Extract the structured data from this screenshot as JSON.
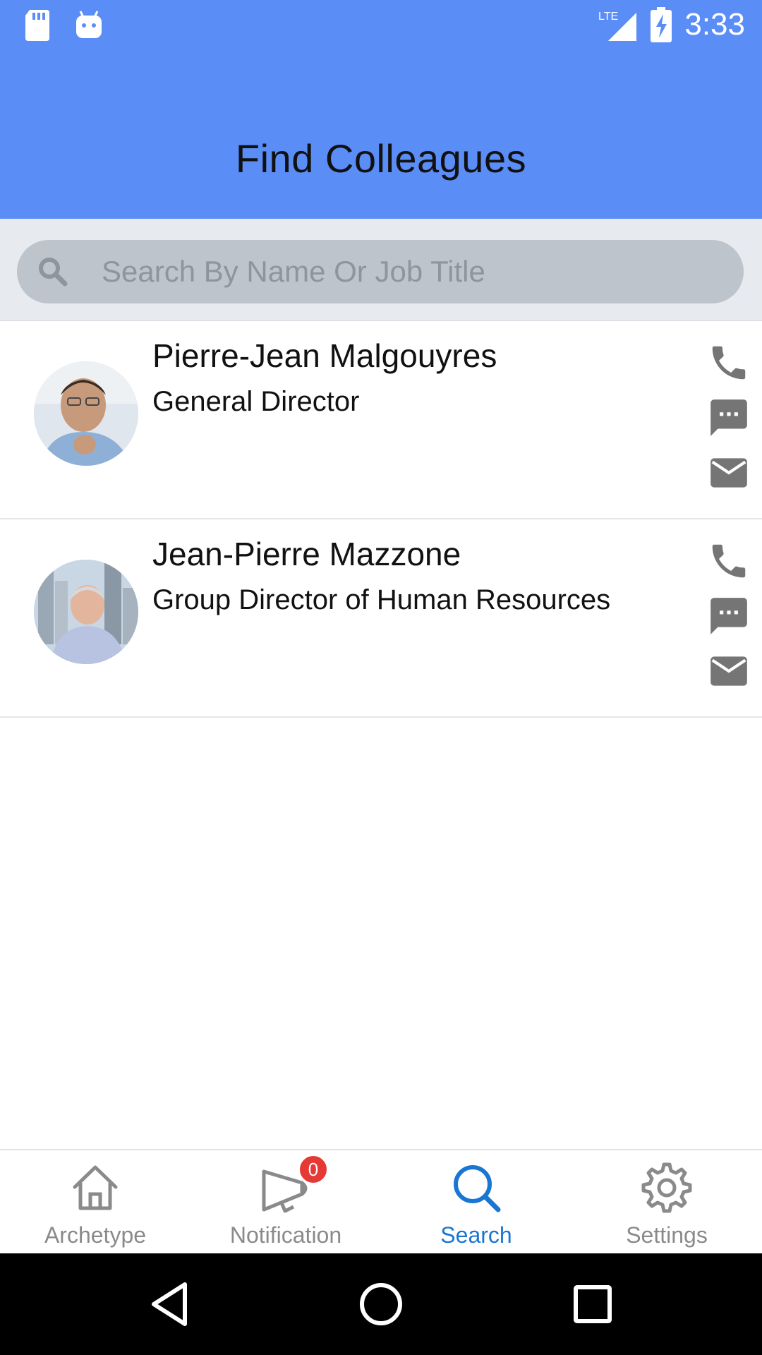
{
  "status_bar": {
    "time": "3:33",
    "network": "LTE",
    "left_icons": [
      "sd-card-icon",
      "android-icon"
    ],
    "right_icons": [
      "lte-signal-icon",
      "battery-charging-icon"
    ]
  },
  "header": {
    "title": "Find Colleagues",
    "background": "#5A8DF5"
  },
  "search": {
    "placeholder": "Search By Name Or Job Title",
    "value": ""
  },
  "colleagues": [
    {
      "name": "Pierre-Jean Malgouyres",
      "title": "General Director",
      "actions": [
        "phone-icon",
        "message-icon",
        "email-icon"
      ]
    },
    {
      "name": "Jean-Pierre Mazzone",
      "title": "Group Director of Human Resources",
      "actions": [
        "phone-icon",
        "message-icon",
        "email-icon"
      ]
    }
  ],
  "tabs": [
    {
      "label": "Archetype",
      "icon": "home-icon",
      "active": false
    },
    {
      "label": "Notification",
      "icon": "megaphone-icon",
      "active": false,
      "badge": "0"
    },
    {
      "label": "Search",
      "icon": "search-icon",
      "active": true
    },
    {
      "label": "Settings",
      "icon": "gear-icon",
      "active": false
    }
  ],
  "colors": {
    "accent": "#1976D2",
    "inactive": "#8A8A8A",
    "badge": "#E53935",
    "action_icon": "#757575"
  }
}
